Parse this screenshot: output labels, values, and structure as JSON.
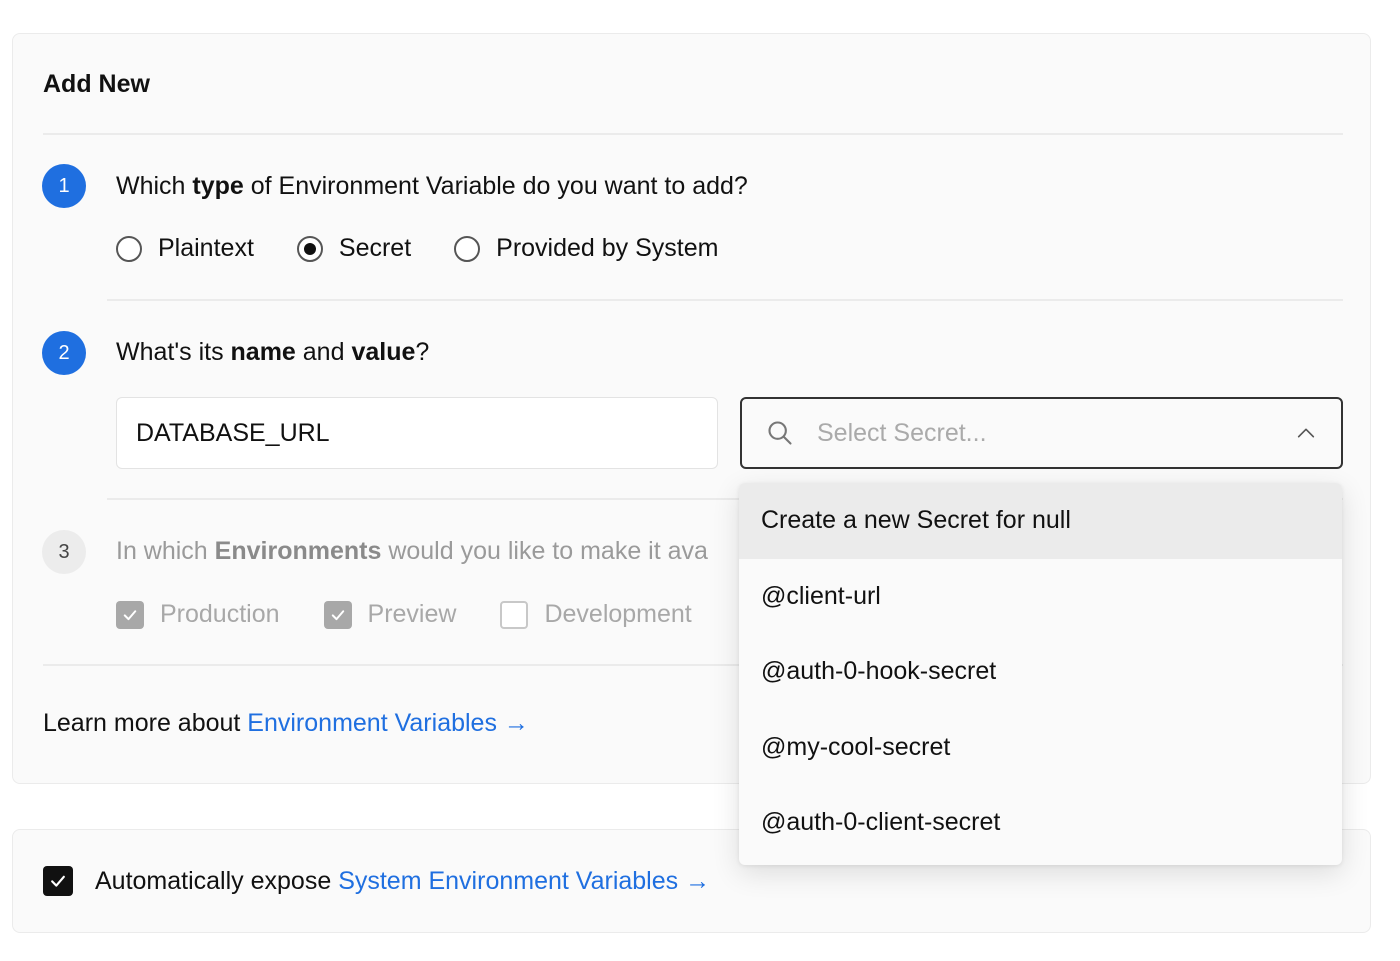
{
  "form": {
    "title": "Add New",
    "step1": {
      "number": "1",
      "q_pre": "Which ",
      "q_bold": "type",
      "q_post": " of Environment Variable do you want to add?",
      "options": [
        {
          "label": "Plaintext",
          "checked": false
        },
        {
          "label": "Secret",
          "checked": true
        },
        {
          "label": "Provided by System",
          "checked": false
        }
      ]
    },
    "step2": {
      "number": "2",
      "q_pre": "What's its ",
      "q_bold1": "name",
      "q_mid": " and ",
      "q_bold2": "value",
      "q_post": "?",
      "name_value": "DATABASE_URL",
      "secret_placeholder": "Select Secret..."
    },
    "step3": {
      "number": "3",
      "q_pre": "In which ",
      "q_bold": "Environments",
      "q_post": " would you like to make it ava",
      "options": [
        {
          "label": "Production",
          "checked": true
        },
        {
          "label": "Preview",
          "checked": true
        },
        {
          "label": "Development",
          "checked": false
        }
      ]
    },
    "learn_more": {
      "text": "Learn more about ",
      "link": "Environment Variables →"
    }
  },
  "expose": {
    "checked": true,
    "text": "Automatically expose ",
    "link": "System Environment Variables →"
  },
  "dropdown": {
    "items": [
      "Create a new Secret for null",
      "@client-url",
      "@auth-0-hook-secret",
      "@my-cool-secret",
      "@auth-0-client-secret"
    ]
  },
  "colors": {
    "accent": "#1f6fe0",
    "card_bg": "#fafafa",
    "border": "#ebebeb"
  }
}
